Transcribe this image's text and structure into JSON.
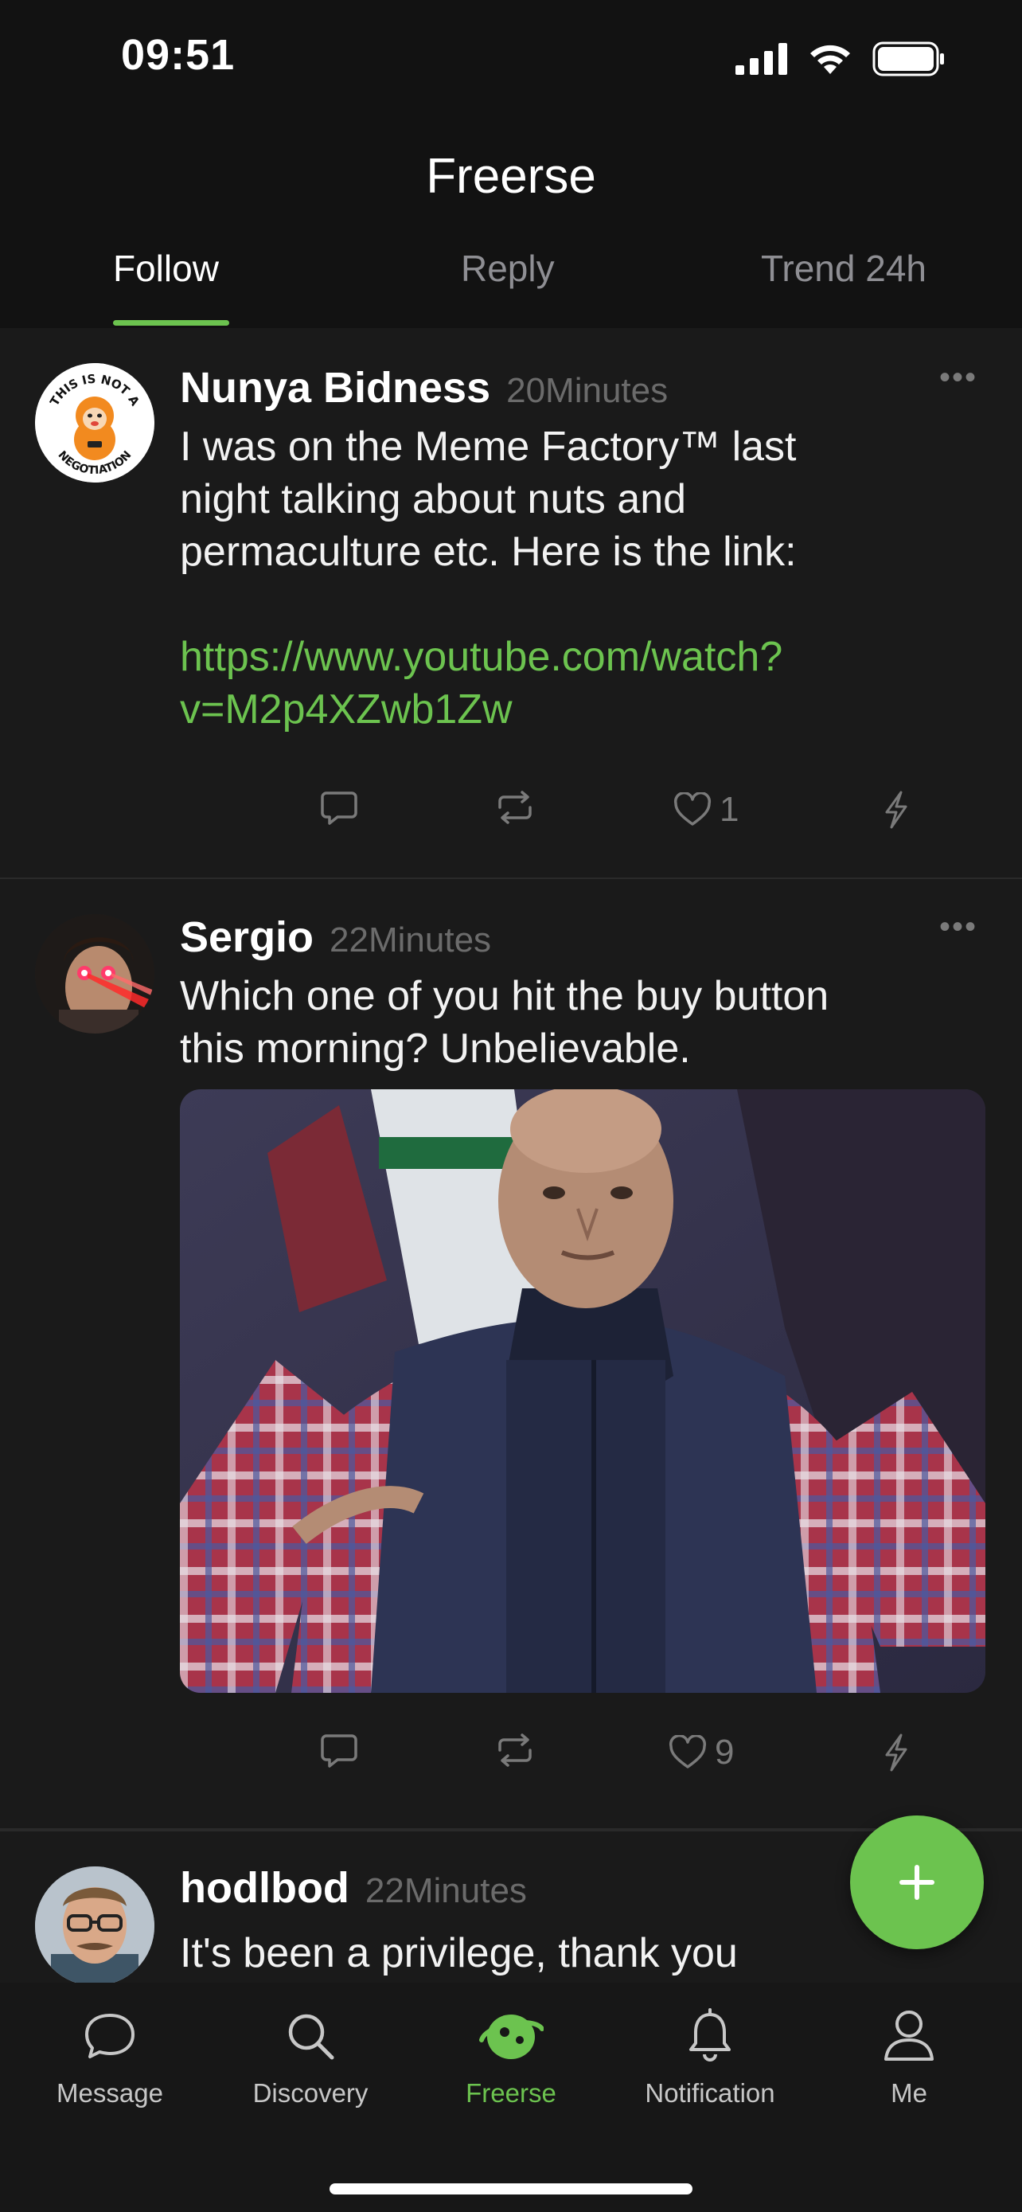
{
  "status_bar": {
    "time": "09:51"
  },
  "header": {
    "title": "Freerse",
    "tabs": [
      {
        "label": "Follow",
        "active": true
      },
      {
        "label": "Reply",
        "active": false
      },
      {
        "label": "Trend 24h",
        "active": false
      }
    ]
  },
  "posts": [
    {
      "author": "Nunya Bidness",
      "time": "20Minutes",
      "text_lines": [
        "I was on the Meme Factory™ last",
        "night talking about nuts and",
        "permaculture etc. Here is the link:"
      ],
      "link_lines": [
        "https://www.youtube.com/watch?",
        "v=M2p4XZwb1Zw"
      ],
      "likes": "1",
      "avatar_badge": "THIS IS NOT A NEGOTIATION"
    },
    {
      "author": "Sergio",
      "time": "22Minutes",
      "text_lines": [
        "Which one of you hit the buy button",
        "this morning? Unbelievable."
      ],
      "likes": "9"
    },
    {
      "author": "hodlbod",
      "time": "22Minutes",
      "text_lines": [
        "It's been a privilege, thank you"
      ]
    }
  ],
  "nav": {
    "items": [
      {
        "label": "Message",
        "icon": "message-icon"
      },
      {
        "label": "Discovery",
        "icon": "search-icon"
      },
      {
        "label": "Freerse",
        "icon": "freerse-logo-icon",
        "active": true
      },
      {
        "label": "Notification",
        "icon": "bell-icon"
      },
      {
        "label": "Me",
        "icon": "person-icon"
      }
    ]
  },
  "colors": {
    "accent": "#6cc34f",
    "background": "#1a1a1a",
    "header": "#121212"
  }
}
